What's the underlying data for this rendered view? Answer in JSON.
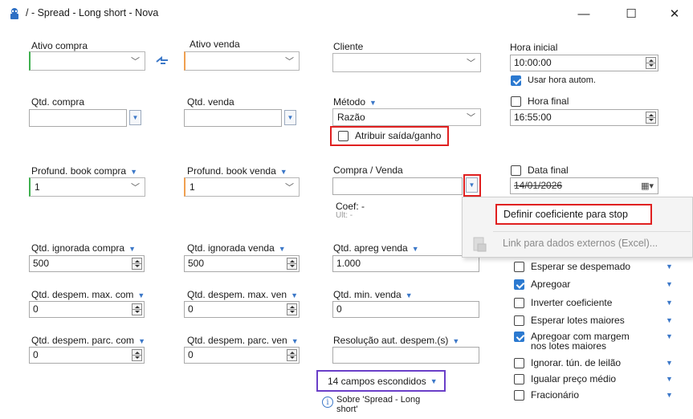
{
  "window": {
    "title": "/ - Spread - Long short - Nova",
    "minimize": "—",
    "maximize": "☐",
    "close": "✕"
  },
  "col1": {
    "ativo_compra": "Ativo compra",
    "ativo_compra_value": "",
    "qtd_compra": "Qtd. compra",
    "qtd_compra_value": "",
    "profund_book_compra": "Profund. book compra",
    "profund_book_compra_value": "1",
    "qtd_ignorada_compra": "Qtd. ignorada compra",
    "qtd_ignorada_compra_value": "500",
    "qtd_desperm_max_com": "Qtd. despem. max. com",
    "qtd_desperm_max_com_value": "0",
    "qtd_desperm_parc_com": "Qtd. despem. parc. com",
    "qtd_desperm_parc_com_value": "0"
  },
  "col2": {
    "ativo_venda": "Ativo venda",
    "ativo_venda_value": "",
    "qtd_venda": "Qtd. venda",
    "qtd_venda_value": "",
    "profund_book_venda": "Profund. book venda",
    "profund_book_venda_value": "1",
    "qtd_ignorada_venda": "Qtd. ignorada venda",
    "qtd_ignorada_venda_value": "500",
    "qtd_desperm_max_ven": "Qtd. despem. max. ven",
    "qtd_desperm_max_ven_value": "0",
    "qtd_desperm_parc_ven": "Qtd. despem. parc. ven",
    "qtd_desperm_parc_ven_value": "0"
  },
  "col3": {
    "cliente": "Cliente",
    "cliente_value": "",
    "metodo": "Método",
    "metodo_value": "Razão",
    "atribuir": "Atribuir saída/ganho",
    "compra_venda": "Compra / Venda",
    "compra_venda_value": "",
    "coef": "Coef: -",
    "ult": "Ult: -",
    "qtd_apreg_venda": "Qtd. apreg venda",
    "qtd_apreg_venda_value": "1.000",
    "qtd_min_venda": "Qtd. min. venda",
    "qtd_min_venda_value": "0",
    "resolucao": "Resolução aut. despem.(s)",
    "resolucao_value": "",
    "hidden_fields": "14 campos escondidos",
    "sobre": "Sobre 'Spread - Long short'"
  },
  "col4": {
    "hora_inicial": "Hora inicial",
    "hora_inicial_value": "10:00:00",
    "usar_hora": "Usar hora autom.",
    "usar_hora_checked": true,
    "hora_final": "Hora final",
    "hora_final_value": "16:55:00",
    "data_final": "Data final",
    "data_final_value": "14/01/2026",
    "options": [
      {
        "label": "Esperar se despemado",
        "checked": false
      },
      {
        "label": "Apregoar",
        "checked": true
      },
      {
        "label": "Inverter coeficiente",
        "checked": false
      },
      {
        "label": "Esperar lotes maiores",
        "checked": false
      },
      {
        "label": "Apregoar com margem nos lotes maiores",
        "checked": true
      },
      {
        "label": "Ignorar. tún. de leilão",
        "checked": false
      },
      {
        "label": "Igualar preço médio",
        "checked": false
      },
      {
        "label": "Fracionário",
        "checked": false
      }
    ]
  },
  "popup": {
    "definir": "Definir coeficiente para stop",
    "link": "Link para dados externos (Excel)..."
  },
  "colors": {
    "accent": "#3c78c8",
    "highlight_red": "#e02020",
    "highlight_purple": "#6a3fc8",
    "green_marker": "#3fb04f",
    "orange_marker": "#f0a050"
  }
}
